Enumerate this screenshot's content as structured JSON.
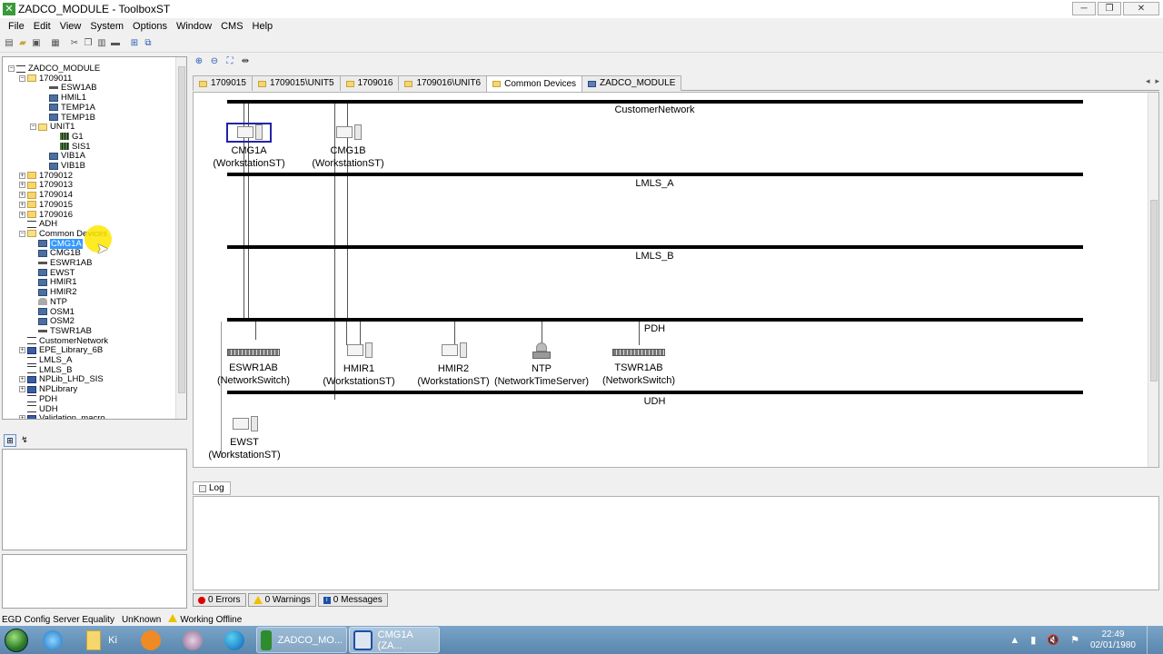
{
  "window": {
    "title": "ZADCO_MODULE - ToolboxST",
    "buttons": [
      "─",
      "❐",
      "✕"
    ]
  },
  "menu": [
    "File",
    "Edit",
    "View",
    "System",
    "Options",
    "Window",
    "CMS",
    "Help"
  ],
  "tree": {
    "root": "ZADCO_MODULE",
    "items": [
      {
        "label": "1709011",
        "icon": "folder-open",
        "exp": "−",
        "indent": 1
      },
      {
        "label": "ESW1AB",
        "icon": "switch",
        "indent": 3
      },
      {
        "label": "HMIL1",
        "icon": "dev",
        "indent": 3
      },
      {
        "label": "TEMP1A",
        "icon": "dev",
        "indent": 3
      },
      {
        "label": "TEMP1B",
        "icon": "dev",
        "indent": 3
      },
      {
        "label": "UNIT1",
        "icon": "folder-open",
        "exp": "−",
        "indent": 2
      },
      {
        "label": "G1",
        "icon": "grid",
        "indent": 4
      },
      {
        "label": "SIS1",
        "icon": "grid",
        "indent": 4
      },
      {
        "label": "VIB1A",
        "icon": "dev",
        "indent": 3
      },
      {
        "label": "VIB1B",
        "icon": "dev",
        "indent": 3
      },
      {
        "label": "1709012",
        "icon": "folder",
        "exp": "+",
        "indent": 1
      },
      {
        "label": "1709013",
        "icon": "folder",
        "exp": "+",
        "indent": 1
      },
      {
        "label": "1709014",
        "icon": "folder",
        "exp": "+",
        "indent": 1
      },
      {
        "label": "1709015",
        "icon": "folder",
        "exp": "+",
        "indent": 1
      },
      {
        "label": "1709016",
        "icon": "folder",
        "exp": "+",
        "indent": 1
      },
      {
        "label": "ADH",
        "icon": "net",
        "indent": 1
      },
      {
        "label": "Common Devices",
        "icon": "folder-open",
        "exp": "−",
        "indent": 1
      },
      {
        "label": "CMG1A",
        "icon": "dev",
        "indent": 2,
        "selected": true
      },
      {
        "label": "CMG1B",
        "icon": "dev",
        "indent": 2
      },
      {
        "label": "ESWR1AB",
        "icon": "switch",
        "indent": 2
      },
      {
        "label": "EWST",
        "icon": "dev",
        "indent": 2
      },
      {
        "label": "HMIR1",
        "icon": "dev",
        "indent": 2
      },
      {
        "label": "HMIR2",
        "icon": "dev",
        "indent": 2
      },
      {
        "label": "NTP",
        "icon": "ntp",
        "indent": 2
      },
      {
        "label": "OSM1",
        "icon": "dev",
        "indent": 2
      },
      {
        "label": "OSM2",
        "icon": "dev",
        "indent": 2
      },
      {
        "label": "TSWR1AB",
        "icon": "switch",
        "indent": 2
      },
      {
        "label": "CustomerNetwork",
        "icon": "net",
        "indent": 1
      },
      {
        "label": "EPE_Library_6B",
        "icon": "lib",
        "exp": "+",
        "indent": 1
      },
      {
        "label": "LMLS_A",
        "icon": "net",
        "indent": 1
      },
      {
        "label": "LMLS_B",
        "icon": "net",
        "indent": 1
      },
      {
        "label": "NPLib_LHD_SIS",
        "icon": "lib",
        "exp": "+",
        "indent": 1
      },
      {
        "label": "NPLibrary",
        "icon": "lib",
        "exp": "+",
        "indent": 1
      },
      {
        "label": "PDH",
        "icon": "net",
        "indent": 1
      },
      {
        "label": "UDH",
        "icon": "net",
        "indent": 1
      },
      {
        "label": "Validation_macro",
        "icon": "lib",
        "exp": "+",
        "indent": 1
      }
    ]
  },
  "tabs": [
    {
      "label": "1709015",
      "icon": "folder"
    },
    {
      "label": "1709015\\UNIT5",
      "icon": "folder"
    },
    {
      "label": "1709016",
      "icon": "folder"
    },
    {
      "label": "1709016\\UNIT6",
      "icon": "folder"
    },
    {
      "label": "Common Devices",
      "icon": "folder",
      "active": true
    },
    {
      "label": "ZADCO_MODULE",
      "icon": "net"
    }
  ],
  "canvas": {
    "networks": [
      "CustomerNetwork",
      "LMLS_A",
      "LMLS_B",
      "PDH",
      "UDH"
    ],
    "devices": [
      {
        "name": "CMG1A",
        "type": "(WorkstationST)"
      },
      {
        "name": "CMG1B",
        "type": "(WorkstationST)"
      },
      {
        "name": "ESWR1AB",
        "type": "(NetworkSwitch)"
      },
      {
        "name": "HMIR1",
        "type": "(WorkstationST)"
      },
      {
        "name": "HMIR2",
        "type": "(WorkstationST)"
      },
      {
        "name": "NTP",
        "type": "(NetworkTimeServer)"
      },
      {
        "name": "TSWR1AB",
        "type": "(NetworkSwitch)"
      },
      {
        "name": "EWST",
        "type": "(WorkstationST)"
      }
    ]
  },
  "log": {
    "tab": "Log",
    "errors": "0 Errors",
    "warnings": "0 Warnings",
    "messages": "0 Messages"
  },
  "status": {
    "egd": "EGD Config Server Equality",
    "state": "UnKnown",
    "mode": "Working Offline"
  },
  "taskbar": {
    "windows": [
      {
        "label": "ZADCO_MO...",
        "color": "#2e8b2e"
      },
      {
        "label": "CMG1A (ZA...",
        "color": "#1c4fa8"
      }
    ],
    "folder_label": "Ki",
    "time": "22:49",
    "date": "02/01/1980"
  }
}
